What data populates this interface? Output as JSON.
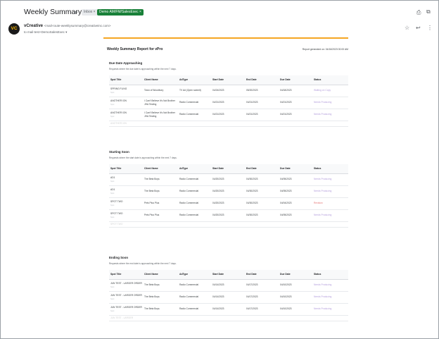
{
  "email": {
    "subject": "Weekly Summary",
    "labels": {
      "inbox": "Inbox ×",
      "demo": "Demo AM/FM/SalesExec ×"
    },
    "avatar": "VC",
    "sender_name": "vCreative",
    "sender_email": "<mail-route-weeklysummary@creativeinc.com>",
    "recipient": "to mail-test+DemoSalesExec ▾"
  },
  "report": {
    "title": "Weekly Summary Report for vPro",
    "generated": "Report generated on: 04/16/2023 00:00 AM",
    "columns": [
      "Spot Title",
      "Client Name",
      "AdType",
      "Start Date",
      "End Date",
      "Due Date",
      "Status"
    ],
    "sections": [
      {
        "title": "Due Date Approaching",
        "desc": "Requests where the due date is approaching within the next 7 days.",
        "rows": [
          {
            "spot": "SPRING FLING",
            "sub": "Spot",
            "client": "Town of Woodbury",
            "adtype": "TV Ad (Open submit)",
            "start": "04/24/2023",
            "end": "05/20/2023",
            "due": "04/18/2023",
            "status": "Waiting on Copy",
            "st": "st-waiting"
          },
          {
            "spot": "ANOTHER ION",
            "sub": "Spot",
            "client": "I Can't Believe It's Not Brother JHA Testing",
            "adtype": "Radio Commercial",
            "start": "04/21/2023",
            "end": "04/21/2023",
            "due": "04/21/2023",
            "status": "Needs Producing",
            "st": "st-needs"
          },
          {
            "spot": "ANOTHER ION",
            "sub": "Spot",
            "client": "I Can't Believe It's Not Brother JHA Testing",
            "adtype": "Radio Commercial",
            "start": "04/21/2023",
            "end": "04/21/2023",
            "due": "04/21/2023",
            "status": "Needs Producing",
            "st": "st-needs"
          }
        ],
        "fade": {
          "spot": "ANOTHER ION",
          "client": "",
          "adtype": "",
          "start": "",
          "end": "",
          "due": "",
          "status": ""
        }
      },
      {
        "title": "Starting Soon",
        "desc": "Requests where the start date is approaching within the next 7 days.",
        "rows": [
          {
            "spot": "AD1",
            "sub": "Spot",
            "client": "The Beta Boys",
            "adtype": "Radio Commercial",
            "start": "04/20/2023",
            "end": "04/30/2023",
            "due": "04/05/2023",
            "status": "Needs Producing",
            "st": "st-needs"
          },
          {
            "spot": "AD1",
            "sub": "Spot",
            "client": "The Beta Boys",
            "adtype": "Radio Commercial",
            "start": "04/20/2023",
            "end": "04/30/2023",
            "due": "04/05/2023",
            "status": "Needs Producing",
            "st": "st-needs"
          },
          {
            "spot": "SPOT TWO",
            "sub": "Spot",
            "client": "Pets Plus Plus",
            "adtype": "Radio Commercial",
            "start": "04/20/2023",
            "end": "04/30/2023",
            "due": "04/04/2023",
            "status": "Revision",
            "st": "st-revision"
          },
          {
            "spot": "SPOT TWO",
            "sub": "Spot",
            "client": "Pets Plus Plus",
            "adtype": "Radio Commercial",
            "start": "04/20/2023",
            "end": "04/30/2023",
            "due": "04/05/2023",
            "status": "Needs Producing",
            "st": "st-needs"
          }
        ],
        "fade": {
          "spot": "SPOT TWO",
          "client": "",
          "adtype": "",
          "start": "",
          "end": "",
          "due": "",
          "status": ""
        }
      },
      {
        "title": "Ending Soon",
        "desc": "Requests where the end date is approaching within the next 7 days.",
        "rows": [
          {
            "spot": "JUN TEST - LARGER ORDER",
            "sub": "Spot",
            "client": "The Beta Boys",
            "adtype": "Radio Commercial",
            "start": "04/14/2023",
            "end": "04/17/2023",
            "due": "04/10/2023",
            "status": "Needs Producing",
            "st": "st-needs"
          },
          {
            "spot": "JUN TEST - LARGER ORDER",
            "sub": "Spot",
            "client": "The Beta Boys",
            "adtype": "Radio Commercial",
            "start": "04/14/2023",
            "end": "04/17/2023",
            "due": "04/10/2023",
            "status": "Needs Producing",
            "st": "st-needs"
          },
          {
            "spot": "JUN TEST - LARGER ORDER",
            "sub": "Spot",
            "client": "The Beta Boys",
            "adtype": "Radio Commercial",
            "start": "04/14/2023",
            "end": "04/17/2023",
            "due": "04/10/2023",
            "status": "Needs Producing",
            "st": "st-needs"
          }
        ],
        "fade": {
          "spot": "JUN TEST - LARGER",
          "client": "",
          "adtype": "",
          "start": "",
          "end": "",
          "due": "",
          "status": ""
        }
      }
    ]
  }
}
